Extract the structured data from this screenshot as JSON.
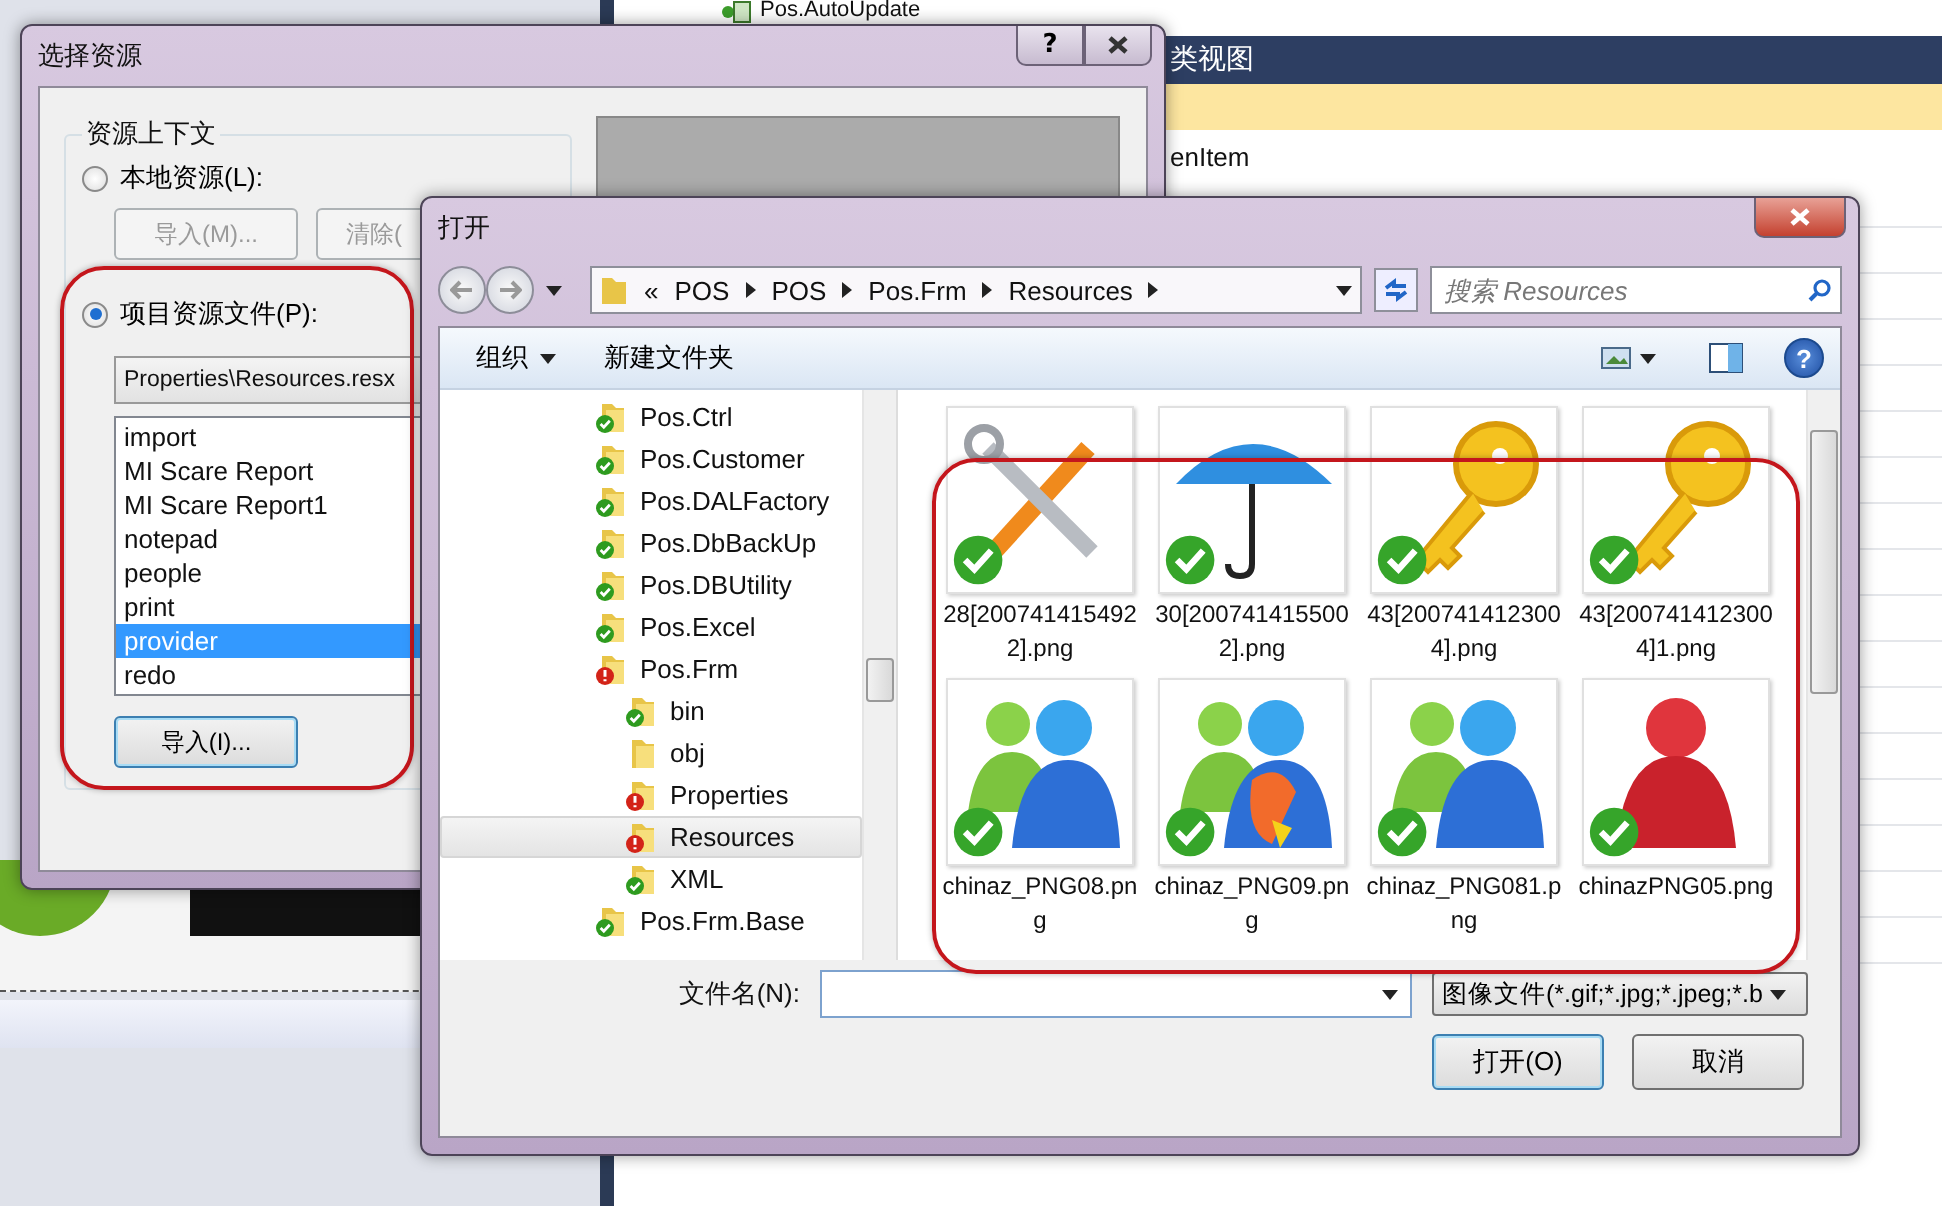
{
  "ide": {
    "tree_item": "Pos.AutoUpdate",
    "class_view": {
      "title": "类视图",
      "item": "enItem"
    }
  },
  "resource_dialog": {
    "title": "选择资源",
    "help_button": "?",
    "group_title": "资源上下文",
    "options": [
      {
        "label": "本地资源(L):",
        "selected": false
      },
      {
        "label": "项目资源文件(P):",
        "selected": true
      }
    ],
    "local_buttons": [
      {
        "label": "导入(M)...",
        "disabled": true
      },
      {
        "label": "清除(",
        "disabled": true
      }
    ],
    "file_dropdown": "Properties\\Resources.resx",
    "resources": [
      {
        "label": "import",
        "selected": false
      },
      {
        "label": "MI Scare Report",
        "selected": false
      },
      {
        "label": "MI Scare Report1",
        "selected": false
      },
      {
        "label": "notepad",
        "selected": false
      },
      {
        "label": "people",
        "selected": false
      },
      {
        "label": "print",
        "selected": false
      },
      {
        "label": "provider",
        "selected": true
      },
      {
        "label": "redo",
        "selected": false
      }
    ],
    "import_button": "导入(I)..."
  },
  "open_dialog": {
    "title": "打开",
    "overflow": "«",
    "breadcrumb": [
      "POS",
      "POS",
      "Pos.Frm",
      "Resources"
    ],
    "search": {
      "placeholder": "搜索 Resources"
    },
    "toolbar": {
      "organize": "组织",
      "new_folder": "新建文件夹",
      "help": "?"
    },
    "folders": [
      {
        "name": "Pos.Ctrl",
        "kind": "ok",
        "selected": false
      },
      {
        "name": "Pos.Customer",
        "kind": "ok",
        "selected": false
      },
      {
        "name": "Pos.DALFactory",
        "kind": "ok",
        "selected": false
      },
      {
        "name": "Pos.DbBackUp",
        "kind": "ok",
        "selected": false
      },
      {
        "name": "Pos.DBUtility",
        "kind": "ok",
        "selected": false
      },
      {
        "name": "Pos.Excel",
        "kind": "ok",
        "selected": false
      },
      {
        "name": "Pos.Frm",
        "kind": "error",
        "selected": false,
        "children": [
          {
            "name": "bin",
            "kind": "ok",
            "selected": false
          },
          {
            "name": "obj",
            "kind": "plain",
            "selected": false
          },
          {
            "name": "Properties",
            "kind": "error",
            "selected": false
          },
          {
            "name": "Resources",
            "kind": "error",
            "selected": true
          },
          {
            "name": "XML",
            "kind": "ok",
            "selected": false
          }
        ]
      },
      {
        "name": "Pos.Frm.Base",
        "kind": "ok",
        "selected": false
      }
    ],
    "files": [
      {
        "name": "28[2007414154922].png",
        "kind": "tools"
      },
      {
        "name": "30[2007414155002].png",
        "kind": "umbrella"
      },
      {
        "name": "43[2007414123004].png",
        "kind": "key"
      },
      {
        "name": "43[2007414123004]1.png",
        "kind": "key"
      },
      {
        "name": "chinaz_PNG08.png",
        "kind": "people"
      },
      {
        "name": "chinaz_PNG09.png",
        "kind": "peoplecolor"
      },
      {
        "name": "chinaz_PNG081.png",
        "kind": "people"
      },
      {
        "name": "chinazPNG05.png",
        "kind": "person"
      }
    ],
    "file_name_label": "文件名(N):",
    "file_type": "图像文件(*.gif;*.jpg;*.jpeg;*.b",
    "buttons": [
      {
        "label": "打开(O)",
        "kind": "primary"
      },
      {
        "label": "取消",
        "kind": "normal"
      }
    ]
  }
}
